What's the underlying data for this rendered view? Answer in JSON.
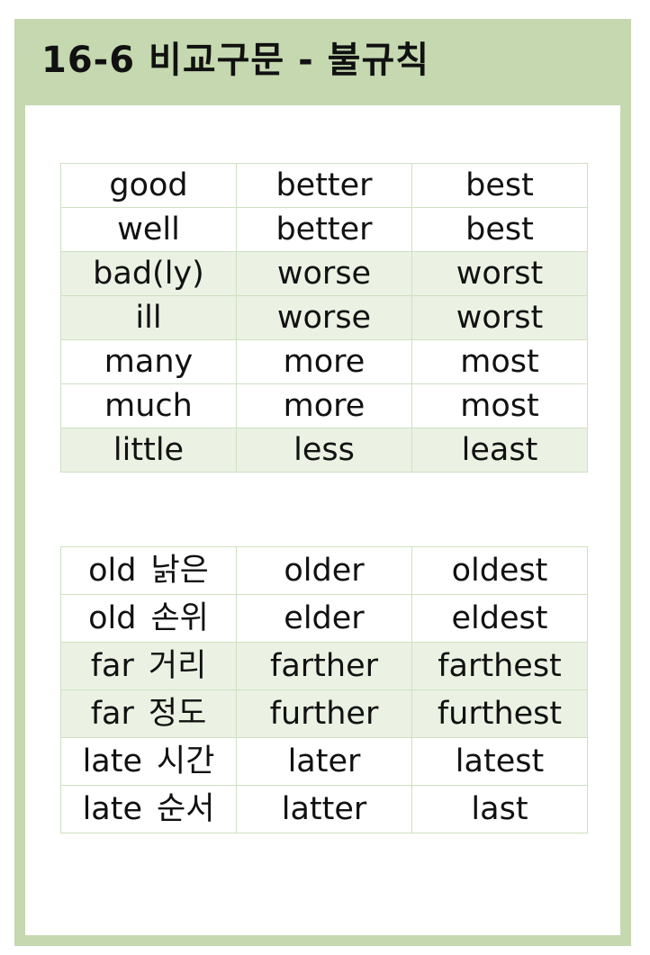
{
  "title": "16-6 비교구문 - 불규칙",
  "table1": [
    {
      "base": "good",
      "comparative": "better",
      "superlative": "best"
    },
    {
      "base": "well",
      "comparative": "better",
      "superlative": "best"
    },
    {
      "base": "bad(ly)",
      "comparative": "worse",
      "superlative": "worst"
    },
    {
      "base": "ill",
      "comparative": "worse",
      "superlative": "worst"
    },
    {
      "base": "many",
      "comparative": "more",
      "superlative": "most"
    },
    {
      "base": "much",
      "comparative": "more",
      "superlative": "most"
    },
    {
      "base": "little",
      "comparative": "less",
      "superlative": "least"
    }
  ],
  "table2": [
    {
      "base": "old",
      "meaning": "낡은",
      "comparative": "older",
      "superlative": "oldest"
    },
    {
      "base": "old",
      "meaning": "손위",
      "comparative": "elder",
      "superlative": "eldest"
    },
    {
      "base": "far",
      "meaning": "거리",
      "comparative": "farther",
      "superlative": "farthest"
    },
    {
      "base": "far",
      "meaning": "정도",
      "comparative": "further",
      "superlative": "furthest"
    },
    {
      "base": "late",
      "meaning": "시간",
      "comparative": "later",
      "superlative": "latest"
    },
    {
      "base": "late",
      "meaning": "순서",
      "comparative": "latter",
      "superlative": "last"
    }
  ],
  "colors": {
    "frame": "#c5d8b0",
    "row_shade": "#ebf2e3",
    "border": "#cfe0c2",
    "text": "#111111"
  }
}
